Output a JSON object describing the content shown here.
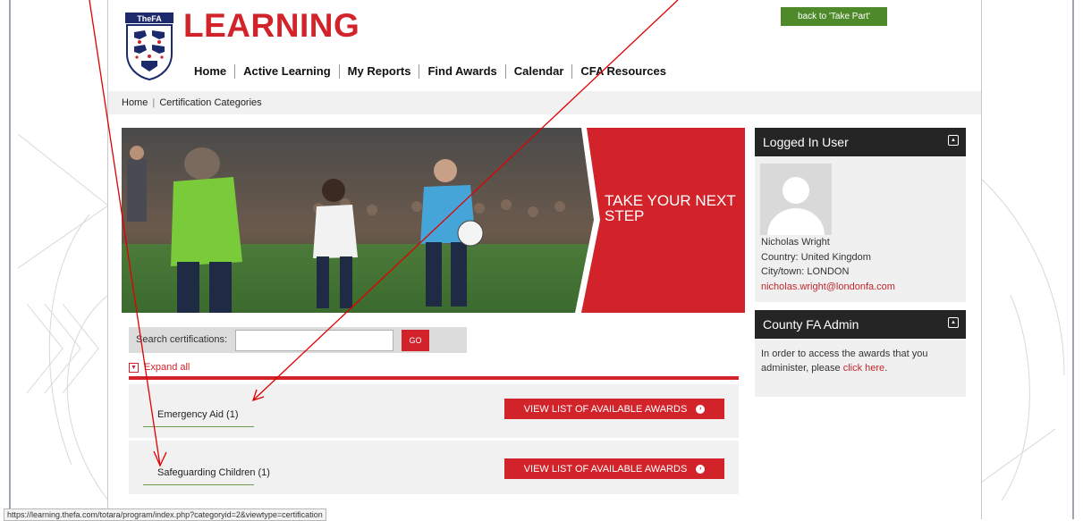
{
  "header": {
    "logo_text": "TheFA",
    "site_title": "LEARNING",
    "back_button": "back to 'Take Part'"
  },
  "nav": {
    "items": [
      {
        "label": "Home"
      },
      {
        "label": "Active Learning"
      },
      {
        "label": "My Reports"
      },
      {
        "label": "Find Awards"
      },
      {
        "label": "Calendar"
      },
      {
        "label": "CFA Resources"
      }
    ]
  },
  "breadcrumb": {
    "home": "Home",
    "sep": "|",
    "current": "Certification Categories"
  },
  "hero": {
    "text_line1": "TAKE YOUR NEXT",
    "text_line2": "STEP"
  },
  "search": {
    "label": "Search certifications:",
    "value": "",
    "go": "GO"
  },
  "expand_all": "Expand all",
  "categories": [
    {
      "name": "Emergency Aid (1)",
      "button": "VIEW LIST OF AVAILABLE AWARDS"
    },
    {
      "name": "Safeguarding Children (1)",
      "button": "VIEW LIST OF AVAILABLE AWARDS"
    }
  ],
  "user_panel": {
    "title": "Logged In User",
    "name": "Nicholas Wright",
    "country": "Country: United Kingdom",
    "city": "City/town: LONDON",
    "email": "nicholas.wright@londonfa.com"
  },
  "admin_panel": {
    "title": "County FA Admin",
    "text_line1": "In order to access the awards that you",
    "text_line2_before": "administer, please ",
    "link": "click here",
    "text_line2_after": "."
  },
  "status_url": "https://learning.thefa.com/totara/program/index.php?categoryid=2&viewtype=certification",
  "colors": {
    "brand_red": "#d2232a",
    "green": "#4e8a2a",
    "dark_panel": "#252525"
  }
}
